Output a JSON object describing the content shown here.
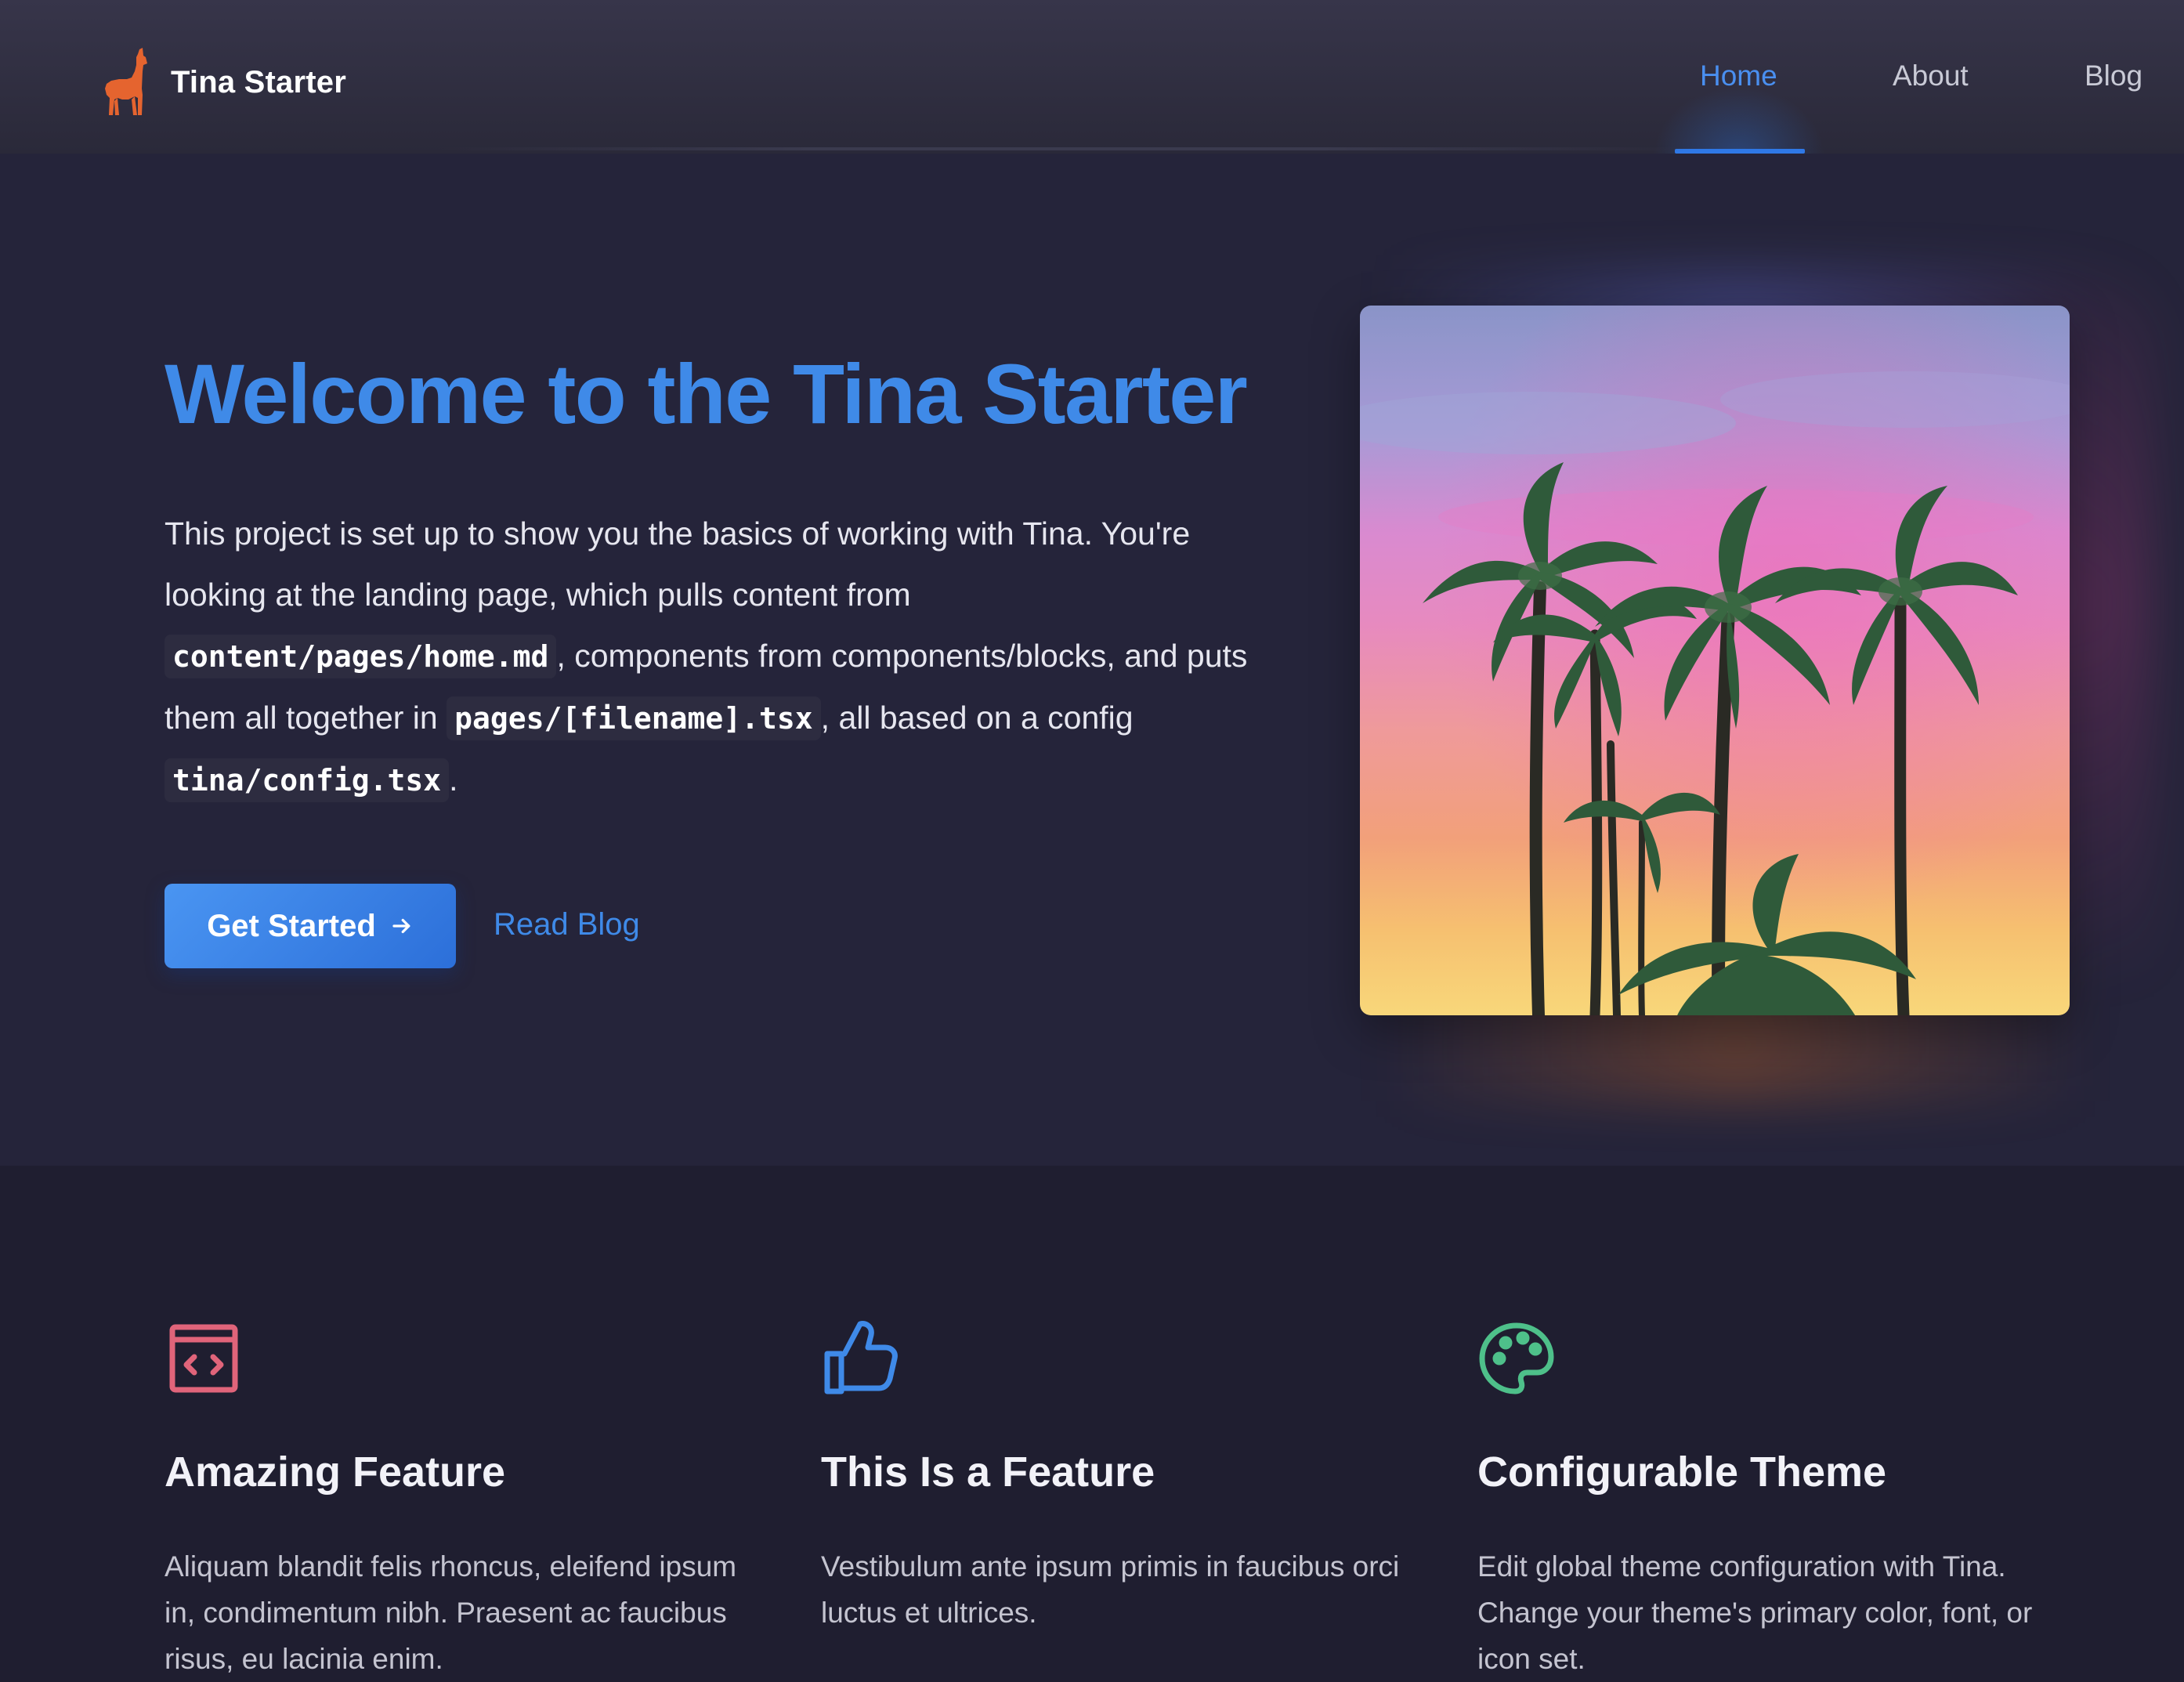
{
  "header": {
    "brand_name": "Tina Starter",
    "nav": [
      {
        "label": "Home",
        "active": true
      },
      {
        "label": "About",
        "active": false
      },
      {
        "label": "Blog",
        "active": false
      }
    ]
  },
  "hero": {
    "title": "Welcome to the Tina Starter",
    "text_1": "This project is set up to show you the basics of working with Tina. You're looking at the landing page, which pulls content from ",
    "code_1": "content/pages/home.md",
    "text_2": ", components from components/blocks, and puts them all together in ",
    "code_2": "pages/[filename].tsx",
    "text_3": ", all based on a config ",
    "code_3": "tina/config.tsx",
    "text_4": ".",
    "primary_button": "Get Started",
    "secondary_link": "Read Blog",
    "image_alt": "palm trees at sunset"
  },
  "features": [
    {
      "icon": "code-window-icon",
      "color": "#e0647a",
      "title": "Amazing Feature",
      "text": "Aliquam blandit felis rhoncus, eleifend ipsum in, condimentum nibh. Praesent ac faucibus risus, eu lacinia enim."
    },
    {
      "icon": "thumbs-up-icon",
      "color": "#3f8ae8",
      "title": "This Is a Feature",
      "text": "Vestibulum ante ipsum primis in faucibus orci luctus et ultrices."
    },
    {
      "icon": "palette-icon",
      "color": "#4ec08a",
      "title": "Configurable Theme",
      "text": "Edit global theme configuration with Tina. Change your theme's primary color, font, or icon set."
    }
  ],
  "colors": {
    "primary": "#3f8ae8",
    "brand_logo": "#e5642f",
    "background": "#1f1e30"
  }
}
